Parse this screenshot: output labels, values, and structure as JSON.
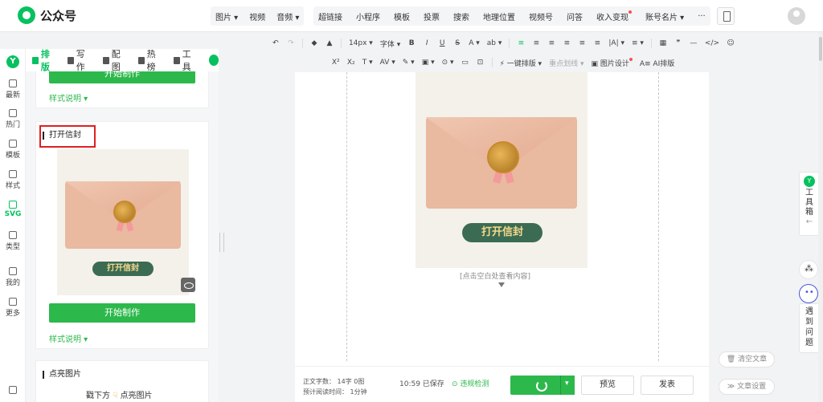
{
  "brand": {
    "name": "公众号"
  },
  "topmenu": {
    "media": [
      "图片",
      "视频",
      "音频"
    ],
    "insert": [
      "超链接",
      "小程序",
      "模板",
      "投票",
      "搜索",
      "地理位置",
      "视频号",
      "问答",
      "收入变现",
      "账号名片",
      "···"
    ]
  },
  "tabs": [
    {
      "label": "排版"
    },
    {
      "label": "写作"
    },
    {
      "label": "配图"
    },
    {
      "label": "热榜"
    },
    {
      "label": "工具"
    }
  ],
  "leftnav": [
    {
      "label": "最新"
    },
    {
      "label": "热门"
    },
    {
      "label": "模板"
    },
    {
      "label": "样式"
    },
    {
      "label": "SVG"
    },
    {
      "label": "类型"
    },
    {
      "label": "我的"
    },
    {
      "label": "更多"
    }
  ],
  "panel": {
    "top_button": "开始制作",
    "top_style": "样式说明 ▾",
    "card_title": "打开信封",
    "card_pill": "打开信封",
    "card_button": "开始制作",
    "card_style": "样式说明 ▾",
    "card2_title": "点亮图片",
    "card2_text": "戳下方",
    "card2_text2": "点亮图片"
  },
  "toolbar": {
    "row1": [
      "↶",
      "↷",
      "◆",
      "▲",
      "14px ▾",
      "字体 ▾",
      "B",
      "I",
      "U",
      "S",
      "A ▾",
      "ab ▾",
      "≡",
      "≡",
      "≡",
      "≡",
      "≡",
      "≡",
      "|A| ▾",
      "≡ ▾",
      "▦",
      "❞",
      "—",
      "</>",
      "☺"
    ],
    "row2": [
      "X²",
      "X₂",
      "T ▾",
      "AV ▾",
      "✎ ▾",
      "▣ ▾",
      "⊙ ▾",
      "▭",
      "⊡",
      "⚡ 一键排版 ▾",
      "重点划线 ▾",
      "图片设计",
      "AI排版"
    ]
  },
  "editor": {
    "pill": "打开信封",
    "hint": "[点击空白处查看内容]"
  },
  "bottom": {
    "word_label": "正文字数：",
    "word_value": "14字 0图",
    "time_label": "预计阅读时间：",
    "time_value": "1分钟",
    "saved": "10:59 已保存",
    "check": "违规检测",
    "preview": "预览",
    "publish": "发表"
  },
  "right": {
    "clear": "清空文章",
    "settings": "文章设置",
    "toolbox": "工\n具\n箱",
    "feedback": "遇\n到\n问\n题"
  },
  "colors": {
    "accent": "#07c160",
    "green_btn": "#2db84c",
    "pill": "#3b6b53",
    "highlight": "#e02020"
  }
}
